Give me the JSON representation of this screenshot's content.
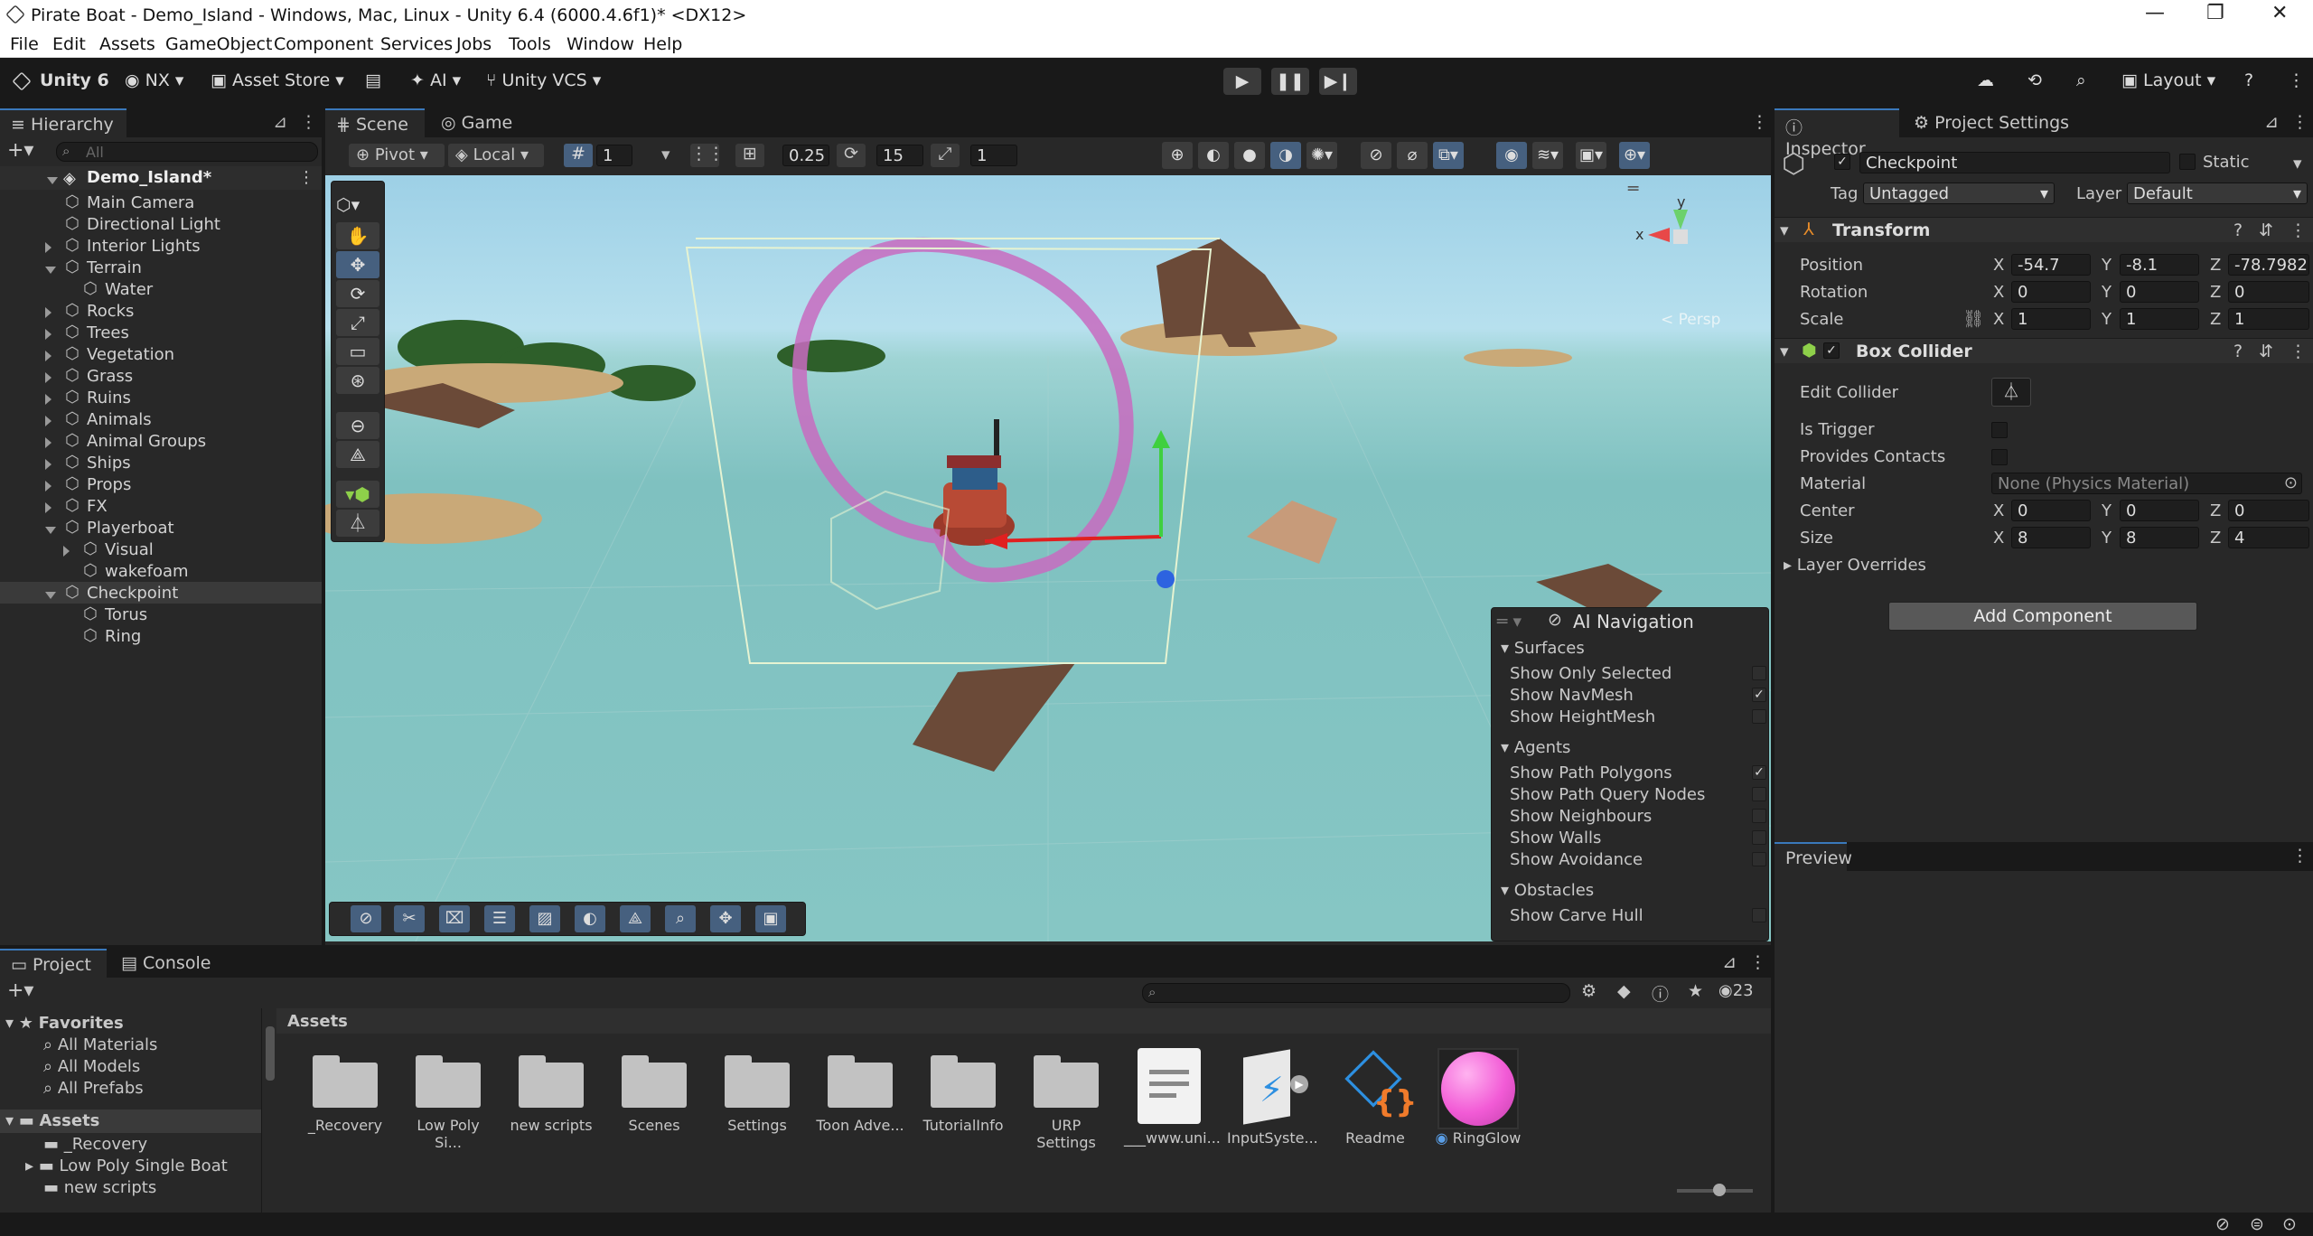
{
  "window": {
    "title": "Pirate Boat - Demo_Island - Windows, Mac, Linux - Unity 6.4 (6000.4.6f1)* <DX12>",
    "minimize": "—",
    "maximize": "❐",
    "close": "✕"
  },
  "menu": [
    "File",
    "Edit",
    "Assets",
    "GameObject",
    "Component",
    "Services",
    "Jobs",
    "Tools",
    "Window",
    "Help"
  ],
  "toolbar": {
    "unity": "Unity 6",
    "account": "NX",
    "asset_store": "Asset Store",
    "ai": "AI",
    "vcs": "Unity VCS",
    "layout": "Layout"
  },
  "hierarchy": {
    "tab": "Hierarchy",
    "search_placeholder": "All",
    "scene": "Demo_Island*",
    "items": [
      {
        "label": "Main Camera"
      },
      {
        "label": "Directional Light"
      },
      {
        "label": "Interior Lights"
      },
      {
        "label": "Terrain"
      },
      {
        "label": "Water"
      },
      {
        "label": "Rocks"
      },
      {
        "label": "Trees"
      },
      {
        "label": "Vegetation"
      },
      {
        "label": "Grass"
      },
      {
        "label": "Ruins"
      },
      {
        "label": "Animals"
      },
      {
        "label": "Animal Groups"
      },
      {
        "label": "Ships"
      },
      {
        "label": "Props"
      },
      {
        "label": "FX"
      },
      {
        "label": "Playerboat"
      },
      {
        "label": "Visual"
      },
      {
        "label": "wakefoam"
      },
      {
        "label": "Checkpoint"
      },
      {
        "label": "Torus"
      },
      {
        "label": "Ring"
      }
    ]
  },
  "scene": {
    "tab_scene": "Scene",
    "tab_game": "Game",
    "pivot": "Pivot",
    "local": "Local",
    "grid": "1",
    "snap": "0.25",
    "angle": "15",
    "scale_snap": "1",
    "persp": "< Persp",
    "gizmo_y": "y",
    "gizmo_x": "x"
  },
  "ainav": {
    "title": "AI Navigation",
    "surfaces": "Surfaces",
    "show_only_selected": "Show Only Selected",
    "show_navmesh": "Show NavMesh",
    "show_heightmesh": "Show HeightMesh",
    "agents": "Agents",
    "show_path_polygons": "Show Path Polygons",
    "show_path_query_nodes": "Show Path Query Nodes",
    "show_neighbours": "Show Neighbours",
    "show_walls": "Show Walls",
    "show_avoidance": "Show Avoidance",
    "obstacles": "Obstacles",
    "show_carve_hull": "Show Carve Hull",
    "check": "✓"
  },
  "inspector": {
    "tab": "Inspector",
    "tab2": "Project Settings",
    "name": "Checkpoint",
    "static": "Static",
    "tag_label": "Tag",
    "tag": "Untagged",
    "layer_label": "Layer",
    "layer": "Default",
    "transform": {
      "title": "Transform",
      "position": "Position",
      "rotation": "Rotation",
      "scale": "Scale",
      "px": "-54.7",
      "py": "-8.1",
      "pz": "-78.79828",
      "rx": "0",
      "ry": "0",
      "rz": "0",
      "sx": "1",
      "sy": "1",
      "sz": "1"
    },
    "collider": {
      "title": "Box Collider",
      "edit": "Edit Collider",
      "is_trigger": "Is Trigger",
      "provides_contacts": "Provides Contacts",
      "material": "Material",
      "material_value": "None (Physics Material)",
      "center": "Center",
      "size": "Size",
      "cx": "0",
      "cy": "0",
      "cz": "0",
      "sx": "8",
      "sy": "8",
      "sz": "4",
      "layer_overrides": "Layer Overrides"
    },
    "add_component": "Add Component",
    "preview": "Preview",
    "X": "X",
    "Y": "Y",
    "Z": "Z"
  },
  "project": {
    "tab": "Project",
    "tab2": "Console",
    "favorites": "Favorites",
    "fav": [
      "All Materials",
      "All Models",
      "All Prefabs"
    ],
    "assets_root": "Assets",
    "tree": [
      "_Recovery",
      "Low Poly Single Boat",
      "new scripts"
    ],
    "breadcrumb": "Assets",
    "count": "23",
    "assets": [
      "_Recovery",
      "Low Poly Si...",
      "new scripts",
      "Scenes",
      "Settings",
      "Toon Adve...",
      "TutorialInfo",
      "URP Settings",
      "___www.uni...",
      "InputSyste...",
      "Readme",
      "RingGlow"
    ]
  }
}
